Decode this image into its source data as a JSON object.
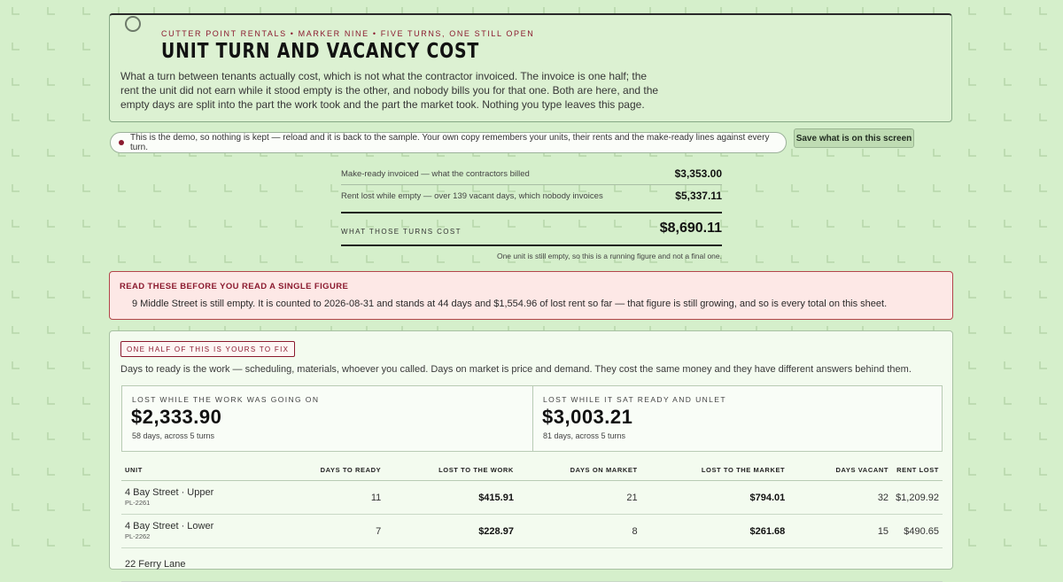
{
  "header": {
    "kicker": "CUTTER POINT RENTALS • MARKER NINE • FIVE TURNS, ONE STILL OPEN",
    "title": "UNIT TURN AND VACANCY COST",
    "intro": "What a turn between tenants actually cost, which is not what the contractor invoiced. The invoice is one half; the rent the unit did not earn while it stood empty is the other, and nobody bills you for that one. Both are here, and the empty days are split into the part the work took and the part the market took. Nothing you type leaves this page."
  },
  "demo_notice": "This is the demo, so nothing is kept — reload and it is back to the sample. Your own copy remembers your units, their rents and the make-ready lines against every turn.",
  "save_button": "Save what is on this screen",
  "summary": {
    "rows": [
      {
        "label": "Make-ready invoiced — what the contractors billed",
        "amount": "$3,353.00"
      },
      {
        "label": "Rent lost while empty — over 139 vacant days, which nobody invoices",
        "amount": "$5,337.11"
      }
    ],
    "total_label": "WHAT THOSE TURNS COST",
    "total_amount": "$8,690.11",
    "note": "One unit is still empty, so this is a running figure and not a final one."
  },
  "alert": {
    "title": "READ THESE BEFORE YOU READ A SINGLE FIGURE",
    "text": "9 Middle Street is still empty. It is counted to 2026-08-31 and stands at 44 days and $1,554.96 of lost rent so far — that figure is still growing, and so is every total on this sheet."
  },
  "split_section": {
    "tag": "ONE HALF OF THIS IS YOURS TO FIX",
    "description": "Days to ready is the work — scheduling, materials, whoever you called. Days on market is price and demand. They cost the same money and they have different answers behind them.",
    "work": {
      "label": "LOST WHILE THE WORK WAS GOING ON",
      "amount": "$2,333.90",
      "sub": "58 days, across 5 turns"
    },
    "market": {
      "label": "LOST WHILE IT SAT READY AND UNLET",
      "amount": "$3,003.21",
      "sub": "81 days, across 5 turns"
    }
  },
  "table": {
    "headers": {
      "unit": "UNIT",
      "days_ready": "DAYS TO READY",
      "lost_work": "LOST TO THE WORK",
      "days_market": "DAYS ON MARKET",
      "lost_market": "LOST TO THE MARKET",
      "days_vacant": "DAYS VACANT",
      "rent_lost": "RENT LOST"
    },
    "rows": [
      {
        "name": "4 Bay Street · Upper",
        "code": "PL-2261",
        "days_ready": "11",
        "lost_work": "$415.91",
        "days_market": "21",
        "lost_market": "$794.01",
        "days_vacant": "32",
        "rent_lost": "$1,209.92"
      },
      {
        "name": "4 Bay Street · Lower",
        "code": "PL-2262",
        "days_ready": "7",
        "lost_work": "$228.97",
        "days_market": "8",
        "lost_market": "$261.68",
        "days_vacant": "15",
        "rent_lost": "$490.65"
      },
      {
        "name": "22 Ferry Lane",
        "code": "",
        "days_ready": "",
        "lost_work": "",
        "days_market": "",
        "lost_market": "",
        "days_vacant": "",
        "rent_lost": ""
      }
    ]
  },
  "colors": {
    "background": "#d5efcb",
    "accent": "#8b1a2f",
    "alert_bg": "#fde8e6",
    "card_bg": "#f3fbef"
  }
}
